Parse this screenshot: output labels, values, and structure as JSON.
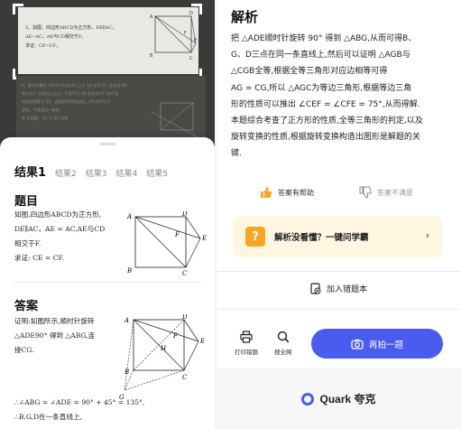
{
  "photo": {
    "problem_lines": [
      "5、如图，四边形ABCD为正方形，DE∥AC，",
      "AE=AC，AE与CD相交于F。",
      "求证：CE=CF。"
    ],
    "fig_labels": [
      "A",
      "B",
      "C",
      "D",
      "E",
      "F"
    ],
    "blur_lines": [
      "6、菱中折叠纸 ABCD 中点在BC上点 AB 边为 BC 延长线 BD",
      "到分点 F 在直线上上点，平面平行 AB 延长线 EC 和平面",
      "的面积相等于 BE，由面积所得四边形，FE 的平行于",
      "面积。不能通过一段线",
      "若 求出题：AD 与 BC 过程"
    ]
  },
  "tabs": [
    "结果1",
    "结果2",
    "结果3",
    "结果4",
    "结果5"
  ],
  "problem": {
    "heading": "题目",
    "lines": [
      "如图,四边形ABCD为正方形,",
      "DE∥AC，AE = AC,AE与CD",
      "相交于F.",
      "求证: CE = CF."
    ]
  },
  "answer": {
    "heading": "答案",
    "lines": [
      "证明:如图所示,顺时针旋转",
      "△ADE90° 得到 △ABG,连",
      "接CG."
    ],
    "calc_lines": [
      "∴∠ABG = ∠ADE = 90° + 45° = 135°,",
      "∴B,G,D在一条直线上,"
    ]
  },
  "fig_labels_problem": [
    "A",
    "B",
    "C",
    "D",
    "E",
    "F"
  ],
  "fig_labels_answer": [
    "A",
    "B",
    "C",
    "D",
    "E",
    "F",
    "G",
    "H"
  ],
  "analysis": {
    "title": "解析",
    "lines": [
      "把 △ADE顺时针旋转 90° 得到 △ABG,从而可得B、",
      "G、D三点在同一条直线上,然后可以证明 △AGB与",
      "△CGB全等,根据全等三角形对应边相等可得",
      "AG = CG,所以 △AGC为等边三角形,根据等边三角",
      "形的性质可以推出 ∠CEF = ∠CFE = 75°,从而得解.",
      "本题综合考查了正方形的性质,全等三角形的判定,以及",
      "旋转变换的性质,根据旋转变换构造出图形是解题的关",
      "键."
    ]
  },
  "feedback": {
    "helpful": "答案有帮助",
    "unhelpful": "答案不满意"
  },
  "banner": {
    "icon_text": "?",
    "text": "解析没看懂？一键问学霸",
    "chevron": "›"
  },
  "add_wrong": "加入错题本",
  "tools": {
    "print": "打印错题",
    "search": "搜全网"
  },
  "shoot": "再拍一题",
  "brand": "Quark 夸克",
  "colors": {
    "accent": "#4a5cf0",
    "banner_bg": "#fff6e2",
    "help_icon": "#f6a623"
  }
}
